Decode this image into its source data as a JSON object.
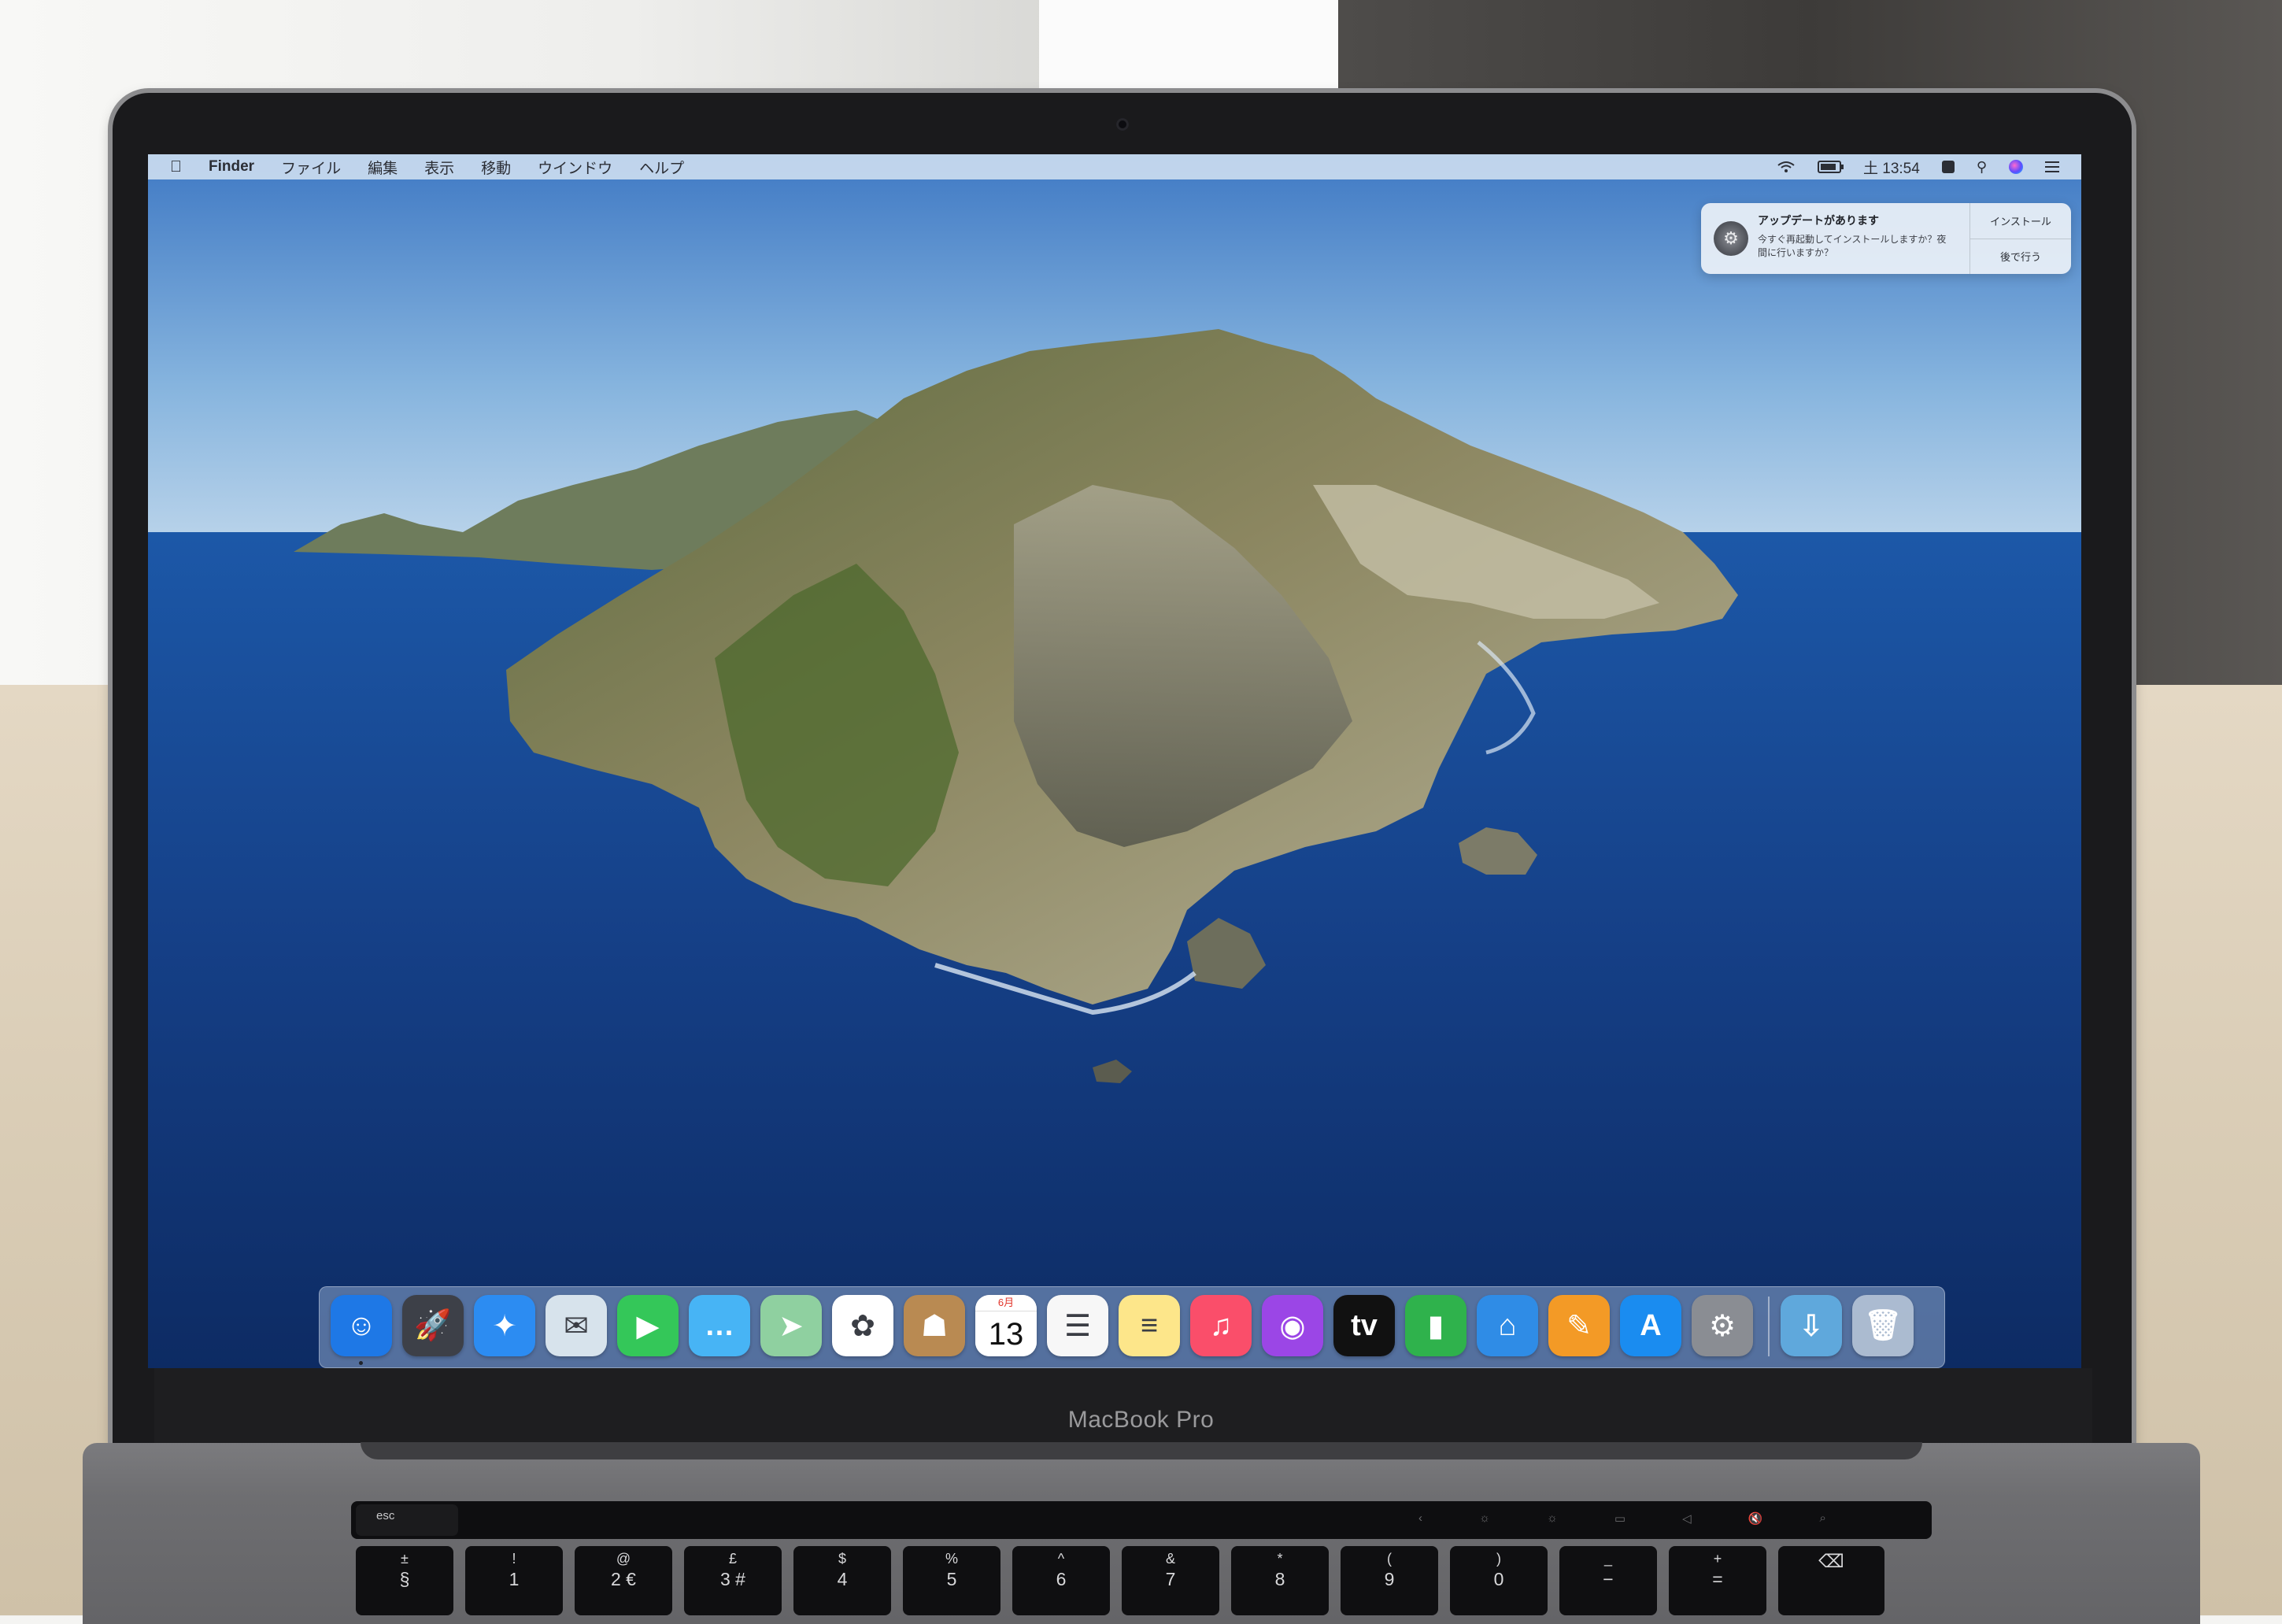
{
  "menubar": {
    "apple": "",
    "app_name": "Finder",
    "menus": [
      "ファイル",
      "編集",
      "表示",
      "移動",
      "ウインドウ",
      "ヘルプ"
    ],
    "clock": "土 13:54",
    "battery_level": 0.85
  },
  "notification": {
    "title": "アップデートがあります",
    "body_line1": "今すぐ再起動してインストールしますか？夜",
    "body_line2": "間に行いますか？",
    "install_label": "インストール",
    "later_label": "後で行う"
  },
  "dock": {
    "apps": [
      {
        "name": "finder-icon",
        "glyph": "☺",
        "bg": "#1e78e6",
        "running": true
      },
      {
        "name": "launchpad-icon",
        "glyph": "🚀",
        "bg": "#3d4048",
        "running": false
      },
      {
        "name": "safari-icon",
        "glyph": "✦",
        "bg": "#2c8cf2",
        "running": false
      },
      {
        "name": "mail-icon",
        "glyph": "✉",
        "bg": "#d7e3ec",
        "running": false
      },
      {
        "name": "facetime-icon",
        "glyph": "▶",
        "bg": "#34c759",
        "running": false
      },
      {
        "name": "messages-icon",
        "glyph": "…",
        "bg": "#47b4f5",
        "running": false
      },
      {
        "name": "maps-icon",
        "glyph": "➤",
        "bg": "#8fd0a0",
        "running": false
      },
      {
        "name": "photos-icon",
        "glyph": "✿",
        "bg": "#ffffff",
        "running": false
      },
      {
        "name": "contacts-icon",
        "glyph": "☗",
        "bg": "#b98a52",
        "running": false
      },
      {
        "name": "calendar-icon",
        "glyph": "",
        "bg": "#ffffff",
        "running": false
      },
      {
        "name": "reminders-icon",
        "glyph": "☰",
        "bg": "#f7f7f7",
        "running": false
      },
      {
        "name": "notes-icon",
        "glyph": "≡",
        "bg": "#fde68a",
        "running": false
      },
      {
        "name": "music-icon",
        "glyph": "♫",
        "bg": "#fa4e6a",
        "running": false
      },
      {
        "name": "podcasts-icon",
        "glyph": "◉",
        "bg": "#9b46e6",
        "running": false
      },
      {
        "name": "tv-icon",
        "glyph": "tv",
        "bg": "#111111",
        "running": false
      },
      {
        "name": "numbers-icon",
        "glyph": "▮",
        "bg": "#2fb24c",
        "running": false
      },
      {
        "name": "keynote-icon",
        "glyph": "⌂",
        "bg": "#2f8ce6",
        "running": false
      },
      {
        "name": "pages-icon",
        "glyph": "✎",
        "bg": "#f39a26",
        "running": false
      },
      {
        "name": "app-store-icon",
        "glyph": "A",
        "bg": "#1a8cf0",
        "running": false
      },
      {
        "name": "system-preferences-icon",
        "glyph": "⚙",
        "bg": "#8a8d93",
        "running": false
      }
    ],
    "calendar": {
      "month": "6月",
      "day": "13"
    },
    "downloads_glyph": "⇩",
    "trash_glyph": "🗑"
  },
  "device": {
    "model": "MacBook Pro"
  },
  "keyboard": {
    "esc": "esc",
    "keys": [
      {
        "top": "±",
        "bottom": "§"
      },
      {
        "top": "!",
        "bottom": "1"
      },
      {
        "top": "@",
        "bottom": "2 €"
      },
      {
        "top": "£",
        "bottom": "3 #"
      },
      {
        "top": "$",
        "bottom": "4"
      },
      {
        "top": "%",
        "bottom": "5"
      },
      {
        "top": "^",
        "bottom": "6"
      },
      {
        "top": "&",
        "bottom": "7"
      },
      {
        "top": "*",
        "bottom": "8"
      },
      {
        "top": "(",
        "bottom": "9"
      },
      {
        "top": ")",
        "bottom": "0"
      },
      {
        "top": "_",
        "bottom": "−"
      },
      {
        "top": "+",
        "bottom": "="
      },
      {
        "top": "",
        "bottom": "⌫"
      }
    ],
    "touchbar_glyphs": [
      "‹",
      "☼",
      "☼",
      "▭",
      "◁",
      "🔇",
      "⌕"
    ]
  }
}
